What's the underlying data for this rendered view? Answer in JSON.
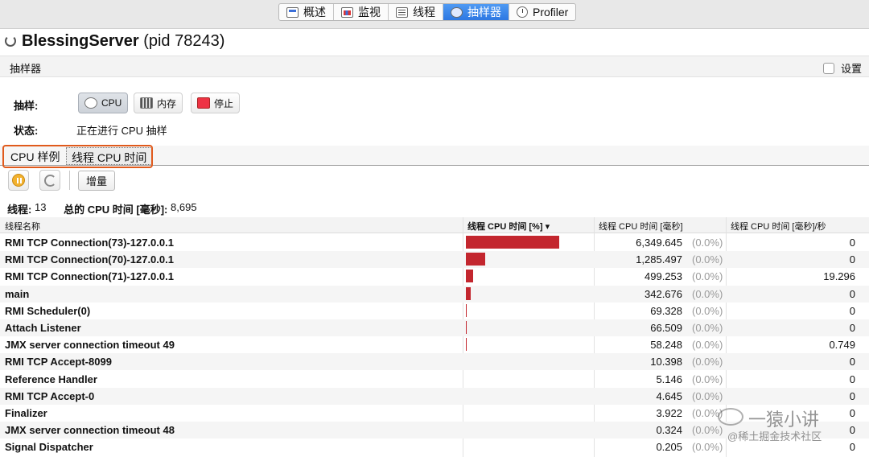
{
  "tabs": [
    {
      "label": "概述",
      "icon": "overview-icon"
    },
    {
      "label": "监视",
      "icon": "monitor-chart-icon"
    },
    {
      "label": "线程",
      "icon": "threads-list-icon"
    },
    {
      "label": "抽样器",
      "icon": "sampler-icon",
      "active": true
    },
    {
      "label": "Profiler",
      "icon": "clock-icon"
    }
  ],
  "header": {
    "app_name": "BlessingServer",
    "pid": "(pid 78243)"
  },
  "section": {
    "label": "抽样器",
    "settings_label": "设置"
  },
  "sample": {
    "label": "抽样:",
    "cpu_button": "CPU",
    "memory_button": "内存",
    "stop_button": "停止"
  },
  "status": {
    "label": "状态:",
    "value": "正在进行 CPU 抽样"
  },
  "subtabs": {
    "cpu_samples": "CPU 样例",
    "thread_cpu_time": "线程 CPU 时间"
  },
  "toolbar": {
    "delta_button": "增量"
  },
  "summary": {
    "threads_label": "线程:",
    "threads_value": "13",
    "total_label": "总的 CPU 时间 [毫秒]:",
    "total_value": "8,695"
  },
  "table": {
    "headers": [
      "线程名称",
      "线程 CPU 时间 [%]",
      "线程 CPU 时间 [毫秒]",
      "线程 CPU 时间 [毫秒]/秒"
    ],
    "sorted_column": 1,
    "rows": [
      {
        "name": "RMI TCP Connection(73)-127.0.0.1",
        "percent": 73.0,
        "ms": "6,349.645",
        "pct": "(0.0%)",
        "rate": "0"
      },
      {
        "name": "RMI TCP Connection(70)-127.0.0.1",
        "percent": 14.8,
        "ms": "1,285.497",
        "pct": "(0.0%)",
        "rate": "0"
      },
      {
        "name": "RMI TCP Connection(71)-127.0.0.1",
        "percent": 5.7,
        "ms": "499.253",
        "pct": "(0.0%)",
        "rate": "19.296"
      },
      {
        "name": "main",
        "percent": 3.9,
        "ms": "342.676",
        "pct": "(0.0%)",
        "rate": "0"
      },
      {
        "name": "RMI Scheduler(0)",
        "percent": 0.8,
        "ms": "69.328",
        "pct": "(0.0%)",
        "rate": "0"
      },
      {
        "name": "Attach Listener",
        "percent": 0.8,
        "ms": "66.509",
        "pct": "(0.0%)",
        "rate": "0"
      },
      {
        "name": "JMX server connection timeout 49",
        "percent": 0.7,
        "ms": "58.248",
        "pct": "(0.0%)",
        "rate": "0.749"
      },
      {
        "name": "RMI TCP Accept-8099",
        "percent": 0.1,
        "ms": "10.398",
        "pct": "(0.0%)",
        "rate": "0"
      },
      {
        "name": "Reference Handler",
        "percent": 0.06,
        "ms": "5.146",
        "pct": "(0.0%)",
        "rate": "0"
      },
      {
        "name": "RMI TCP Accept-0",
        "percent": 0.05,
        "ms": "4.645",
        "pct": "(0.0%)",
        "rate": "0"
      },
      {
        "name": "Finalizer",
        "percent": 0.05,
        "ms": "3.922",
        "pct": "(0.0%)",
        "rate": "0"
      },
      {
        "name": "JMX server connection timeout 48",
        "percent": 0.0,
        "ms": "0.324",
        "pct": "(0.0%)",
        "rate": "0"
      },
      {
        "name": "Signal Dispatcher",
        "percent": 0.0,
        "ms": "0.205",
        "pct": "(0.0%)",
        "rate": "0"
      }
    ]
  },
  "colors": {
    "bar": "#c3262e",
    "highlight": "#e05a1c",
    "active_tab": "#2d78e2"
  },
  "watermark": {
    "line1": "一猿小讲",
    "line2": "@稀土掘金技术社区"
  }
}
